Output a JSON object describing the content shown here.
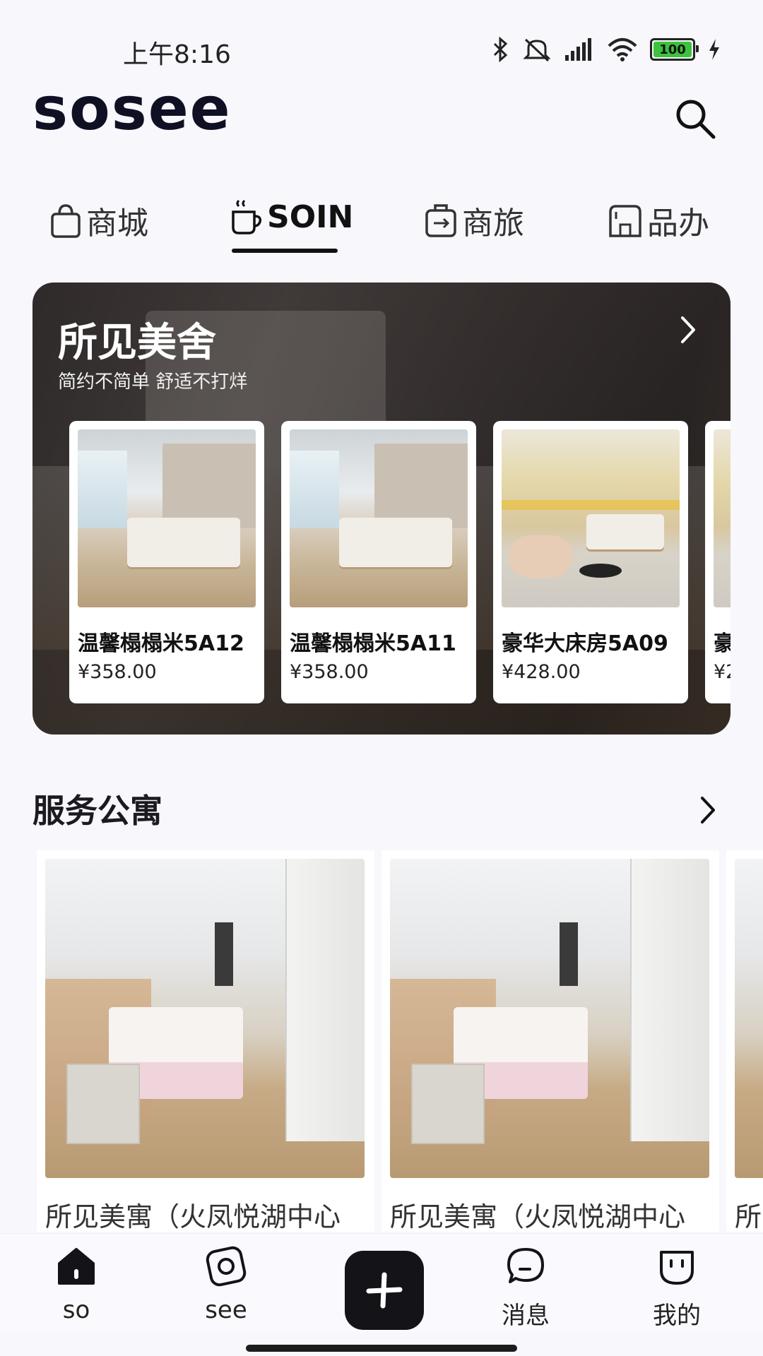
{
  "status_bar": {
    "time": "上午8:16",
    "battery": "100"
  },
  "header": {
    "logo": "sosee"
  },
  "tabs": [
    {
      "label": "商城",
      "icon": "shopping-bag-icon"
    },
    {
      "label": "SOIN",
      "icon": "coffee-cup-icon"
    },
    {
      "label": "商旅",
      "icon": "luggage-icon"
    },
    {
      "label": "品办",
      "icon": "office-building-icon"
    }
  ],
  "banner": {
    "title": "所见美舍",
    "subtitle": "简约不简单 舒适不打烊",
    "hotels": [
      {
        "name": "温馨榻榻米5A12",
        "price": "¥358.00"
      },
      {
        "name": "温馨榻榻米5A11",
        "price": "¥358.00"
      },
      {
        "name": "豪华大床房5A09",
        "price": "¥428.00"
      },
      {
        "name": "豪",
        "price": "¥2"
      }
    ]
  },
  "apartments": {
    "title": "服务公寓",
    "items": [
      {
        "title": "所见美寓（火凤悦湖中心"
      },
      {
        "title": "所见美寓（火凤悦湖中心"
      },
      {
        "title": "所"
      }
    ]
  },
  "bottom_nav": {
    "so": "so",
    "see": "see",
    "messages": "消息",
    "mine": "我的"
  }
}
